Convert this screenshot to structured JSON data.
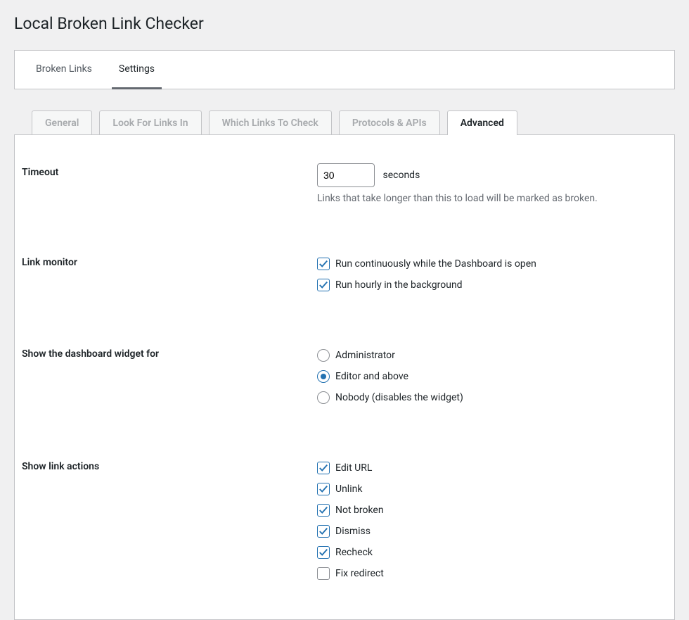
{
  "page": {
    "title": "Local Broken Link Checker"
  },
  "top_tabs": {
    "broken_links": "Broken Links",
    "settings": "Settings"
  },
  "sub_tabs": {
    "general": "General",
    "look_for": "Look For Links In",
    "which_links": "Which Links To Check",
    "protocols": "Protocols & APIs",
    "advanced": "Advanced"
  },
  "timeout": {
    "label": "Timeout",
    "value": "30",
    "unit": "seconds",
    "help": "Links that take longer than this to load will be marked as broken."
  },
  "link_monitor": {
    "label": "Link monitor",
    "continuous": "Run continuously while the Dashboard is open",
    "hourly": "Run hourly in the background"
  },
  "dashboard_widget": {
    "label": "Show the dashboard widget for",
    "administrator": "Administrator",
    "editor_above": "Editor and above",
    "nobody": "Nobody (disables the widget)"
  },
  "link_actions": {
    "label": "Show link actions",
    "edit_url": "Edit URL",
    "unlink": "Unlink",
    "not_broken": "Not broken",
    "dismiss": "Dismiss",
    "recheck": "Recheck",
    "fix_redirect": "Fix redirect"
  }
}
